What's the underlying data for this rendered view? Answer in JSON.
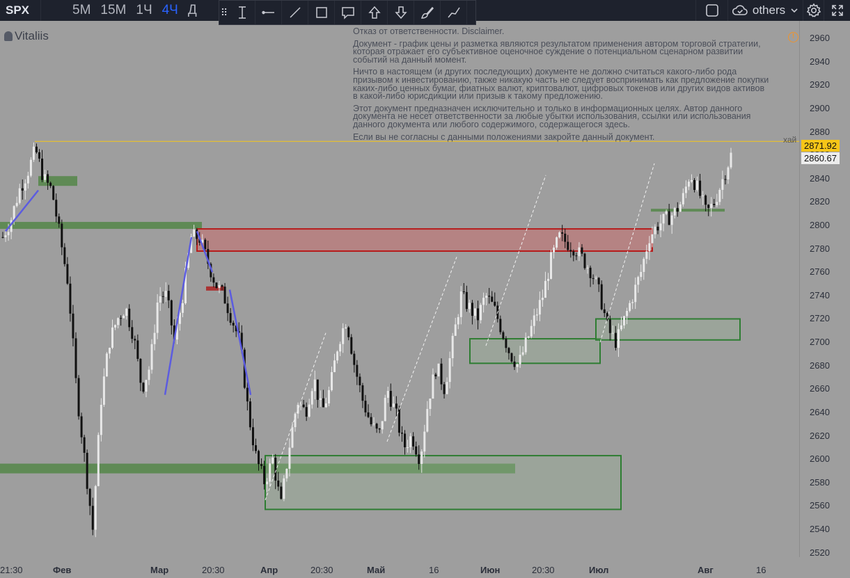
{
  "toolbar": {
    "symbol": "SPX",
    "intervals": [
      {
        "label": "5M",
        "active": false
      },
      {
        "label": "15M",
        "active": false
      },
      {
        "label": "1Ч",
        "active": false
      },
      {
        "label": "4Ч",
        "active": true
      },
      {
        "label": "Д",
        "active": false
      }
    ],
    "drawing_tools": [
      "cursor-text-icon",
      "horizontal-ray-icon",
      "trend-line-icon",
      "rectangle-icon",
      "callout-icon",
      "arrow-up-icon",
      "arrow-down-icon",
      "brush-icon",
      "path-icon"
    ],
    "right": {
      "others_label": "others"
    }
  },
  "chart": {
    "author": "Vitaliis",
    "disclaimer": [
      "Отказ от ответственности. Disclaimer.",
      "Документ - график цены и разметка являются результатом применения автором торговой стратегии, которая отражает его субъективное оценочное суждение о потенциальном сценарном развитии событий на данный момент.",
      "Ничто в настоящем (и других последующих) документе не должно считаться какого-либо рода призывом к инвестированию, также никакую часть не следует воспринимать как предложение покупки каких-либо ценных бумаг, фиатных валют, криптовалют, цифровых токенов или других видов активов в какой-либо юрисдикции или призыв к такому предложению.",
      "Этот документ предназначен исключительно и только в информационных целях. Автор данного документа не несет ответственности за любые убытки использования, ссылки или использования данного документа или любого содержимого, содержащегося здесь.",
      "Если вы не согласны с данными положениями закройте данный документ."
    ],
    "high_label": "хай",
    "high_price": "2871.92",
    "last_price": "2860.67",
    "colors": {
      "background": "#9e9e9e",
      "high_line": "#f5c518",
      "red_zone": "#b71c1c",
      "green_zone": "#2e7d32",
      "trend": "#5c5ce0"
    }
  },
  "chart_data": {
    "type": "candlestick",
    "symbol": "SPX",
    "interval": "4Ч",
    "y_ticks": [
      2960,
      2940,
      2920,
      2900,
      2880,
      2860,
      2840,
      2820,
      2800,
      2780,
      2760,
      2740,
      2720,
      2700,
      2680,
      2660,
      2640,
      2620,
      2600,
      2580,
      2560,
      2540,
      2520
    ],
    "ylim": [
      2512,
      2975
    ],
    "x_ticks": [
      {
        "label": "21:30",
        "bold": false
      },
      {
        "label": "Фев",
        "bold": true
      },
      {
        "label": "Мар",
        "bold": true
      },
      {
        "label": "20:30",
        "bold": false
      },
      {
        "label": "Апр",
        "bold": true
      },
      {
        "label": "20:30",
        "bold": false
      },
      {
        "label": "Май",
        "bold": true
      },
      {
        "label": "16",
        "bold": false
      },
      {
        "label": "Июн",
        "bold": true
      },
      {
        "label": "20:30",
        "bold": false
      },
      {
        "label": "Июл",
        "bold": true
      },
      {
        "label": "Авг",
        "bold": true
      },
      {
        "label": "16",
        "bold": false
      }
    ],
    "high_level": 2871.92,
    "last_price": 2860.67,
    "zones": [
      {
        "kind": "resistance-box",
        "color": "red",
        "top": 2797,
        "bottom": 2778
      },
      {
        "kind": "support-box",
        "color": "green",
        "top": 2603,
        "bottom": 2557
      },
      {
        "kind": "support-box",
        "color": "green",
        "top": 2703,
        "bottom": 2682
      },
      {
        "kind": "support-box",
        "color": "green",
        "top": 2720,
        "bottom": 2702
      }
    ],
    "levels": [
      2838,
      2800,
      2592,
      2813,
      2746
    ],
    "price_path": [
      2790,
      2805,
      2830,
      2845,
      2865,
      2840,
      2830,
      2790,
      2750,
      2660,
      2600,
      2540,
      2650,
      2700,
      2720,
      2730,
      2705,
      2660,
      2680,
      2740,
      2740,
      2700,
      2740,
      2790,
      2790,
      2770,
      2750,
      2740,
      2720,
      2700,
      2640,
      2600,
      2580,
      2600,
      2560,
      2610,
      2650,
      2640,
      2670,
      2640,
      2660,
      2700,
      2720,
      2680,
      2650,
      2630,
      2620,
      2660,
      2640,
      2610,
      2620,
      2600,
      2650,
      2680,
      2660,
      2700,
      2740,
      2730,
      2720,
      2740,
      2730,
      2710,
      2690,
      2680,
      2700,
      2720,
      2740,
      2770,
      2790,
      2785,
      2780,
      2770,
      2760,
      2740,
      2710,
      2700,
      2720,
      2740,
      2760,
      2790,
      2800,
      2805,
      2810,
      2820,
      2845,
      2830,
      2810,
      2820,
      2840,
      2860
    ]
  }
}
